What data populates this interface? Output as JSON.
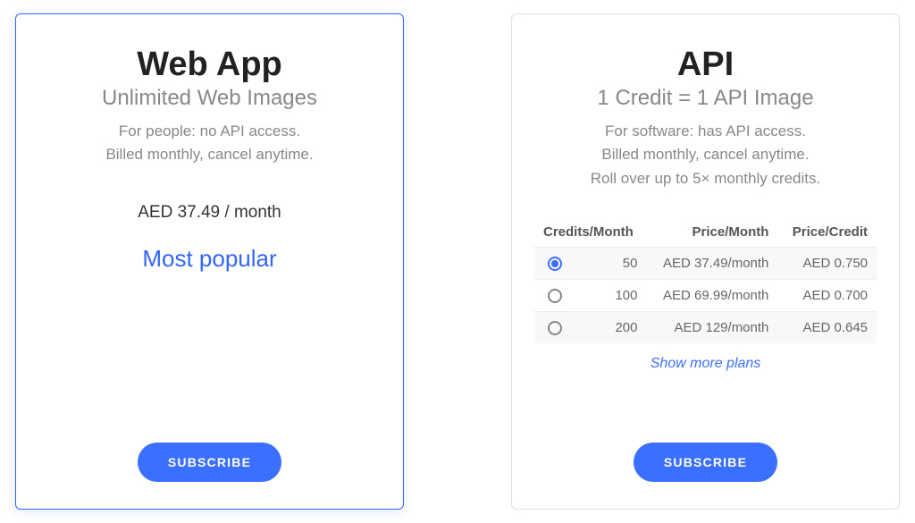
{
  "webapp": {
    "title": "Web App",
    "subtitle": "Unlimited Web Images",
    "desc_line1": "For people: no API access.",
    "desc_line2": "Billed monthly, cancel anytime.",
    "price": "AED 37.49 / month",
    "popular": "Most popular",
    "subscribe": "SUBSCRIBE"
  },
  "api": {
    "title": "API",
    "subtitle": "1 Credit = 1 API Image",
    "desc_line1": "For software: has API access.",
    "desc_line2": "Billed monthly, cancel anytime.",
    "desc_line3": "Roll over up to 5× monthly credits.",
    "table": {
      "headers": {
        "credits": "Credits/Month",
        "price": "Price/Month",
        "unit": "Price/Credit"
      },
      "rows": [
        {
          "selected": true,
          "credits": "50",
          "price": "AED 37.49/month",
          "unit": "AED 0.750"
        },
        {
          "selected": false,
          "credits": "100",
          "price": "AED 69.99/month",
          "unit": "AED 0.700"
        },
        {
          "selected": false,
          "credits": "200",
          "price": "AED 129/month",
          "unit": "AED 0.645"
        }
      ]
    },
    "show_more": "Show more plans",
    "subscribe": "SUBSCRIBE"
  }
}
